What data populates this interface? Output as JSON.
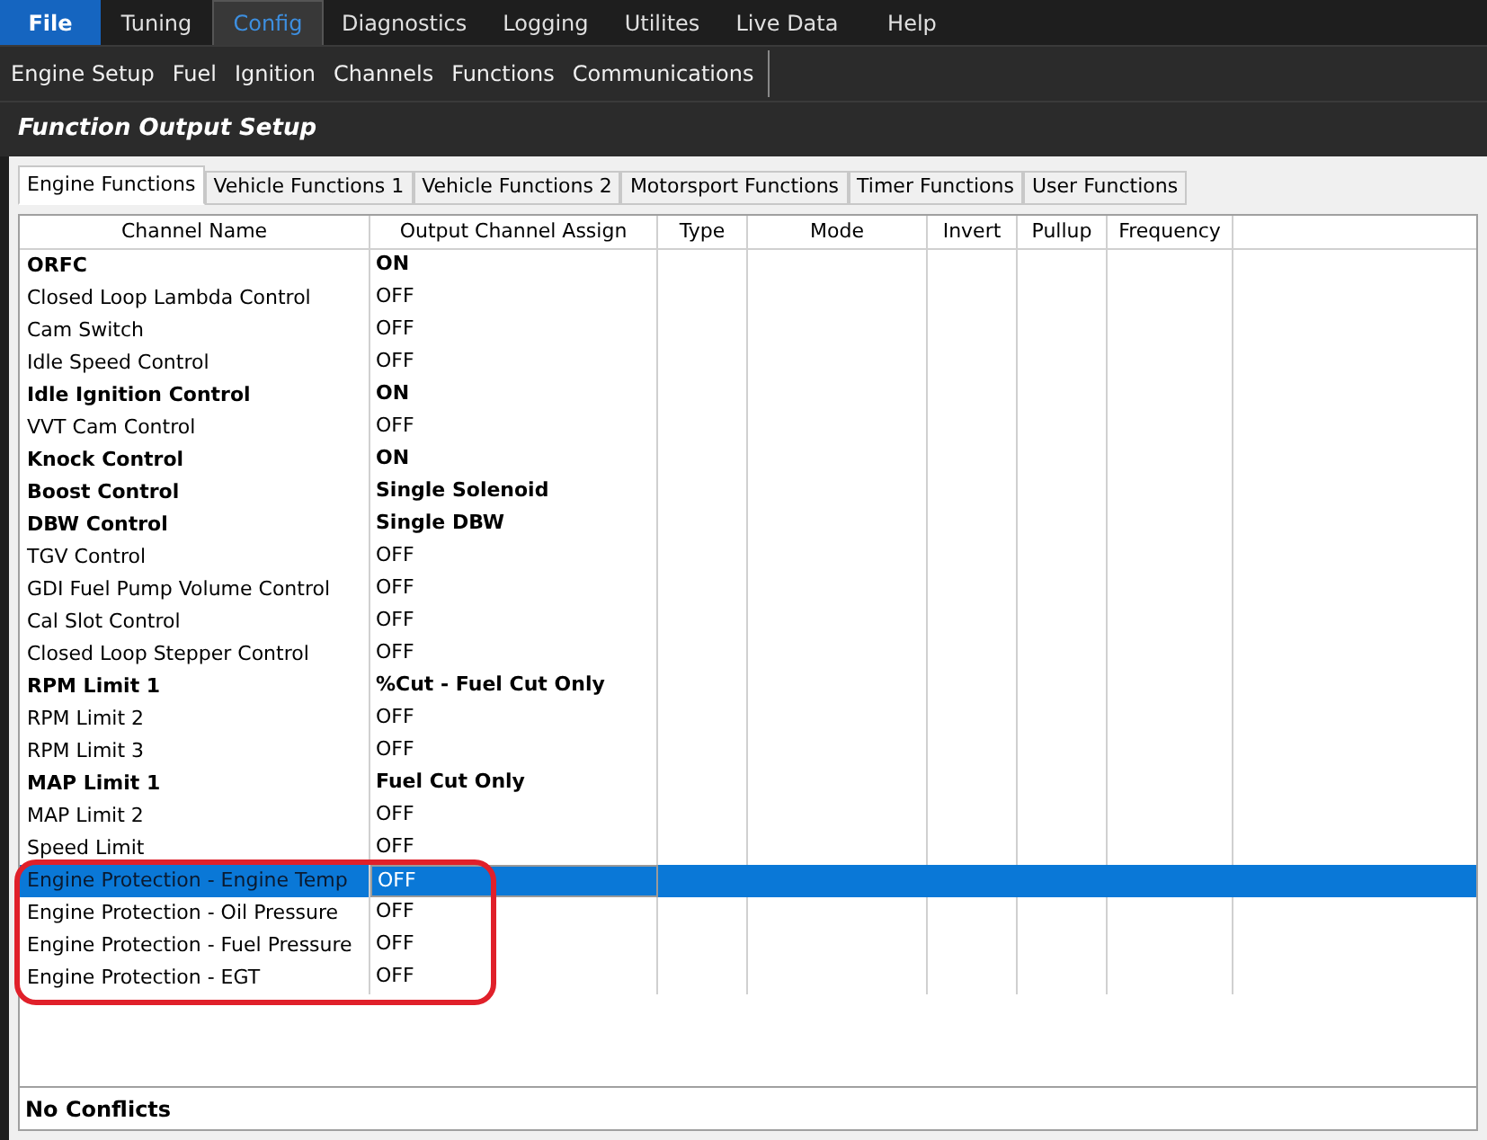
{
  "menu": [
    {
      "label": "File",
      "kind": "file",
      "selected": false
    },
    {
      "label": "Tuning",
      "kind": "tab",
      "selected": false
    },
    {
      "label": "Config",
      "kind": "tab",
      "selected": true
    },
    {
      "label": "Diagnostics",
      "kind": "tab",
      "selected": false
    },
    {
      "label": "Logging",
      "kind": "tab",
      "selected": false
    },
    {
      "label": "Utilites",
      "kind": "tab",
      "selected": false
    },
    {
      "label": "Live Data",
      "kind": "tab",
      "selected": false
    },
    {
      "label": "Help",
      "kind": "tab",
      "selected": false
    }
  ],
  "submenu": [
    "Engine Setup",
    "Fuel",
    "Ignition",
    "Channels",
    "Functions",
    "Communications"
  ],
  "panel": {
    "title": "Function Output Setup"
  },
  "tabs": [
    {
      "label": "Engine Functions",
      "selected": true
    },
    {
      "label": "Vehicle Functions 1",
      "selected": false
    },
    {
      "label": "Vehicle Functions 2",
      "selected": false
    },
    {
      "label": "Motorsport Functions",
      "selected": false
    },
    {
      "label": "Timer Functions",
      "selected": false
    },
    {
      "label": "User Functions",
      "selected": false
    }
  ],
  "table": {
    "columns": [
      "Channel Name",
      "Output Channel Assign",
      "Type",
      "Mode",
      "Invert",
      "Pullup",
      "Frequency"
    ],
    "rows": [
      {
        "name": "ORFC",
        "assign": "ON",
        "active": true,
        "selected": false
      },
      {
        "name": "Closed Loop Lambda Control",
        "assign": "OFF",
        "active": false,
        "selected": false
      },
      {
        "name": "Cam Switch",
        "assign": "OFF",
        "active": false,
        "selected": false
      },
      {
        "name": "Idle Speed Control",
        "assign": "OFF",
        "active": false,
        "selected": false
      },
      {
        "name": "Idle Ignition Control",
        "assign": "ON",
        "active": true,
        "selected": false
      },
      {
        "name": "VVT Cam Control",
        "assign": "OFF",
        "active": false,
        "selected": false
      },
      {
        "name": "Knock Control",
        "assign": "ON",
        "active": true,
        "selected": false
      },
      {
        "name": "Boost Control",
        "assign": "Single Solenoid",
        "active": true,
        "selected": false
      },
      {
        "name": "DBW Control",
        "assign": "Single DBW",
        "active": true,
        "selected": false
      },
      {
        "name": "TGV Control",
        "assign": "OFF",
        "active": false,
        "selected": false
      },
      {
        "name": "GDI Fuel Pump Volume Control",
        "assign": "OFF",
        "active": false,
        "selected": false
      },
      {
        "name": "Cal Slot Control",
        "assign": "OFF",
        "active": false,
        "selected": false
      },
      {
        "name": "Closed Loop Stepper Control",
        "assign": "OFF",
        "active": false,
        "selected": false
      },
      {
        "name": "RPM Limit 1",
        "assign": "%Cut - Fuel Cut Only",
        "active": true,
        "selected": false
      },
      {
        "name": "RPM Limit 2",
        "assign": "OFF",
        "active": false,
        "selected": false
      },
      {
        "name": "RPM Limit 3",
        "assign": "OFF",
        "active": false,
        "selected": false
      },
      {
        "name": "MAP Limit 1",
        "assign": "Fuel Cut Only",
        "active": true,
        "selected": false
      },
      {
        "name": "MAP Limit 2",
        "assign": "OFF",
        "active": false,
        "selected": false
      },
      {
        "name": "Speed Limit",
        "assign": "OFF",
        "active": false,
        "selected": false
      },
      {
        "name": "Engine Protection - Engine Temp",
        "assign": "OFF",
        "active": false,
        "selected": true
      },
      {
        "name": "Engine Protection - Oil Pressure",
        "assign": "OFF",
        "active": false,
        "selected": false
      },
      {
        "name": "Engine Protection - Fuel Pressure",
        "assign": "OFF",
        "active": false,
        "selected": false
      },
      {
        "name": "Engine Protection - EGT",
        "assign": "OFF",
        "active": false,
        "selected": false
      }
    ]
  },
  "status": "No Conflicts"
}
